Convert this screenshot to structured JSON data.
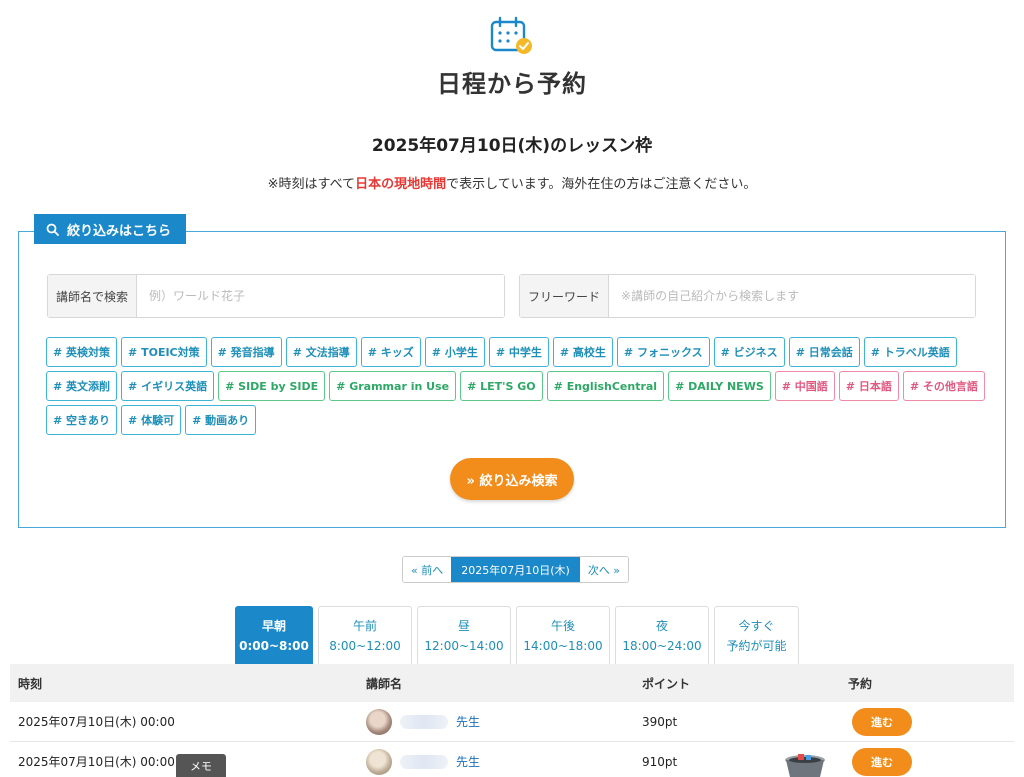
{
  "header": {
    "title": "日程から予約",
    "slot_title": "2025年07月10日(木)のレッスン枠",
    "tz_note_prefix": "※時刻はすべて",
    "tz_note_highlight": "日本の現地時間",
    "tz_note_suffix": "で表示しています。海外在住の方はご注意ください。"
  },
  "filter": {
    "tab_label": "絞り込みはこちら",
    "teacher_label": "講師名で検索",
    "teacher_placeholder": "例）ワールド花子",
    "freeword_label": "フリーワード",
    "freeword_placeholder": "※講師の自己紹介から検索します",
    "tag_rows": [
      [
        {
          "label": "# 英検対策",
          "color": "blue"
        },
        {
          "label": "# TOEIC対策",
          "color": "blue"
        },
        {
          "label": "# 発音指導",
          "color": "blue"
        },
        {
          "label": "# 文法指導",
          "color": "blue"
        },
        {
          "label": "# キッズ",
          "color": "blue"
        },
        {
          "label": "# 小学生",
          "color": "blue"
        },
        {
          "label": "# 中学生",
          "color": "blue"
        },
        {
          "label": "# 高校生",
          "color": "blue"
        },
        {
          "label": "# フォニックス",
          "color": "blue"
        },
        {
          "label": "# ビジネス",
          "color": "blue"
        },
        {
          "label": "# 日常会話",
          "color": "blue"
        },
        {
          "label": "# トラベル英語",
          "color": "blue"
        }
      ],
      [
        {
          "label": "# 英文添削",
          "color": "blue"
        },
        {
          "label": "# イギリス英語",
          "color": "blue"
        },
        {
          "label": "# SIDE by SIDE",
          "color": "green"
        },
        {
          "label": "# Grammar in Use",
          "color": "green"
        },
        {
          "label": "# LET'S GO",
          "color": "green"
        },
        {
          "label": "# EnglishCentral",
          "color": "green"
        },
        {
          "label": "# DAILY NEWS",
          "color": "green"
        },
        {
          "label": "# 中国語",
          "color": "pink"
        },
        {
          "label": "# 日本語",
          "color": "pink"
        },
        {
          "label": "# その他言語",
          "color": "pink"
        }
      ],
      [
        {
          "label": "# 空きあり",
          "color": "blue"
        },
        {
          "label": "# 体験可",
          "color": "blue"
        },
        {
          "label": "# 動画あり",
          "color": "blue"
        }
      ]
    ],
    "submit_label": "» 絞り込み検索"
  },
  "date_nav": {
    "prev": "« 前へ",
    "current": "2025年07月10日(木)",
    "next": "次へ »"
  },
  "time_tabs": [
    {
      "line1": "早朝",
      "line2": "0:00~8:00",
      "active": true
    },
    {
      "line1": "午前",
      "line2": "8:00~12:00",
      "active": false
    },
    {
      "line1": "昼",
      "line2": "12:00~14:00",
      "active": false
    },
    {
      "line1": "午後",
      "line2": "14:00~18:00",
      "active": false
    },
    {
      "line1": "夜",
      "line2": "18:00~24:00",
      "active": false
    },
    {
      "line1": "今すぐ",
      "line2": "予約が可能",
      "active": false
    }
  ],
  "table": {
    "headers": {
      "time": "時刻",
      "teacher": "講師名",
      "point": "ポイント",
      "book": "予約"
    },
    "rows": [
      {
        "time": "2025年07月10日(木) 00:00",
        "teacher": "先生",
        "point": "390pt",
        "action": "進む"
      },
      {
        "time": "2025年07月10日(木) 00:00",
        "teacher": "先生",
        "point": "910pt",
        "action": "進む"
      }
    ]
  },
  "memo_label": "メモ",
  "colors": {
    "accent_blue": "#1a88c9",
    "accent_orange": "#f28c1a",
    "highlight_red": "#e53935"
  }
}
